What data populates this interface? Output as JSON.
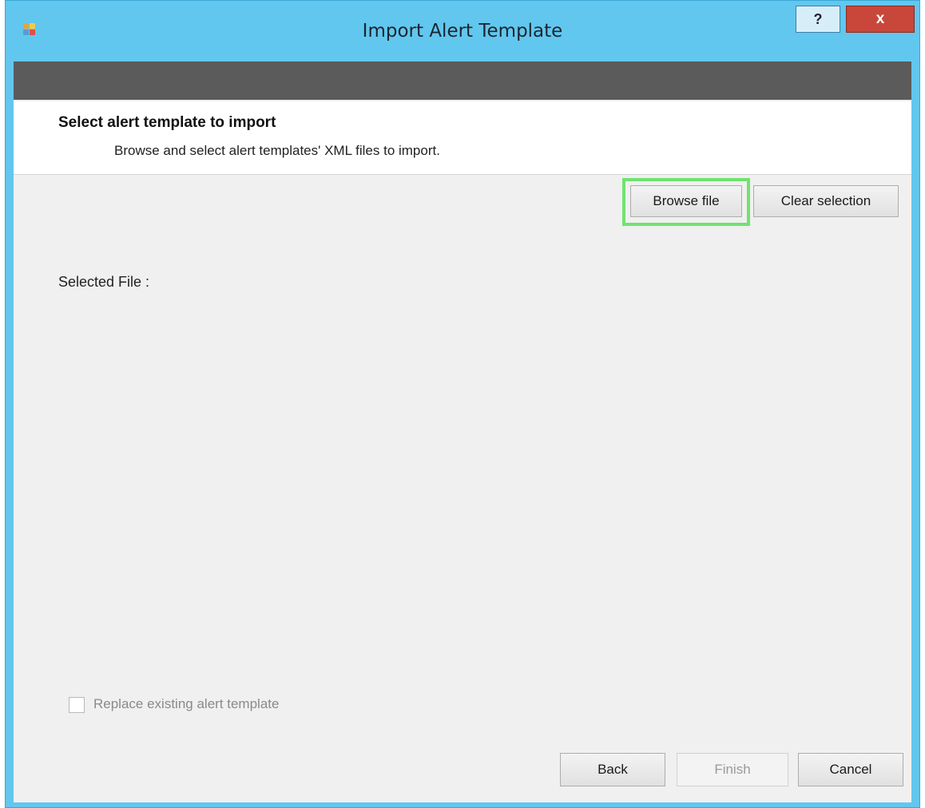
{
  "window": {
    "title": "Import Alert Template",
    "help_label": "?",
    "close_label": "x"
  },
  "header": {
    "title": "Select alert template to import",
    "description": "Browse and select alert templates' XML files to import."
  },
  "actions": {
    "browse_label": "Browse file",
    "clear_label": "Clear selection"
  },
  "selection": {
    "label": "Selected File :"
  },
  "options": {
    "replace_label": "Replace existing alert template",
    "replace_checked": false,
    "replace_enabled": false
  },
  "footer": {
    "back_label": "Back",
    "finish_label": "Finish",
    "finish_enabled": false,
    "cancel_label": "Cancel"
  },
  "colors": {
    "title_bar": "#61c7ee",
    "banner": "#5b5b5b",
    "close_button": "#c9463a",
    "highlight": "#6fe36f"
  }
}
